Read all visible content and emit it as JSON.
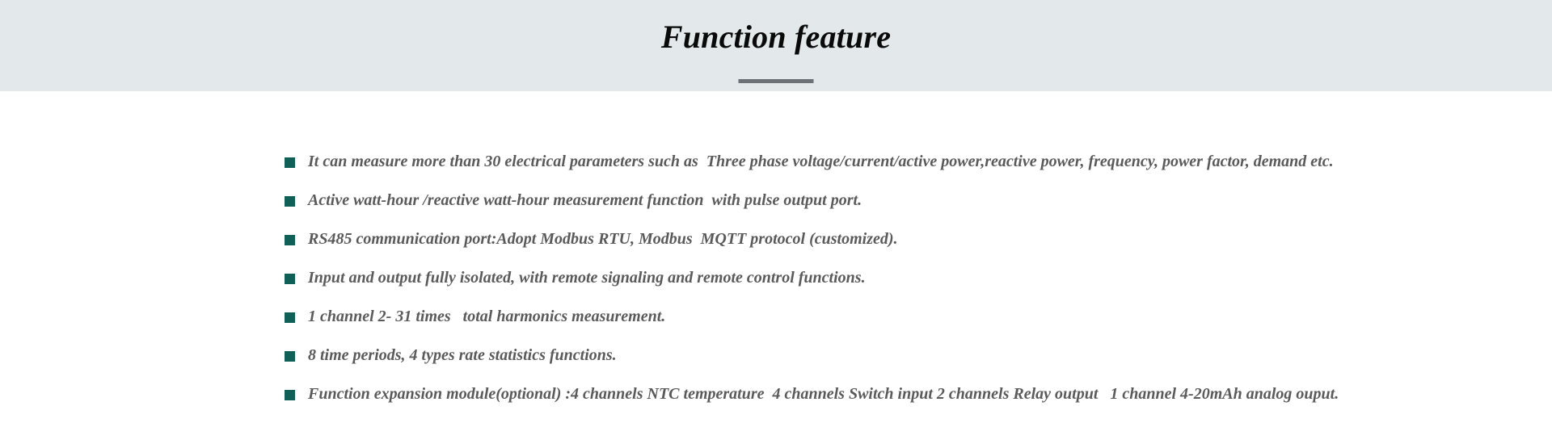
{
  "header": {
    "title": "Function feature",
    "divider": "title-divider",
    "background_color": "#e3e8eb",
    "divider_color": "#6b7177",
    "title_color": "#0a0a0a"
  },
  "features": {
    "bullet_icon": "filled-square-bullet",
    "bullet_color": "#106057",
    "text_color": "#5a5a5a",
    "items": [
      {
        "text": "It can measure more than 30 electrical parameters such as  Three phase voltage/current/active power,reactive power, frequency, power factor, demand etc."
      },
      {
        "text": "Active watt-hour /reactive watt-hour measurement function  with pulse output port."
      },
      {
        "text": "RS485 communication port:Adopt Modbus RTU, Modbus  MQTT protocol (customized)."
      },
      {
        "text": "Input and output fully isolated, with remote signaling and remote control functions."
      },
      {
        "text": "1 channel 2- 31 times   total harmonics measurement."
      },
      {
        "text": "8 time periods, 4 types rate statistics functions."
      },
      {
        "text": "Function expansion module(optional) :4 channels NTC temperature  4 channels Switch input 2 channels Relay output   1 channel 4-20mAh analog ouput."
      }
    ]
  }
}
